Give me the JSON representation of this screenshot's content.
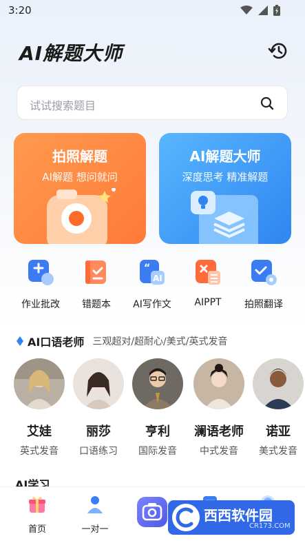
{
  "status_bar": {
    "time": "3:20"
  },
  "header": {
    "title": "AI解题大师"
  },
  "search": {
    "placeholder": "试试搜索题目"
  },
  "cards": [
    {
      "title": "拍照解题",
      "subtitle": "AI解题  想问就问"
    },
    {
      "title": "AI解题大师",
      "subtitle": "深度思考  精准解题"
    }
  ],
  "tools": [
    {
      "label": "作业批改",
      "icon": "homework-check-icon"
    },
    {
      "label": "错题本",
      "icon": "mistake-book-icon"
    },
    {
      "label": "AI写作文",
      "icon": "ai-writing-icon"
    },
    {
      "label": "AIPPT",
      "icon": "ai-ppt-icon"
    },
    {
      "label": "拍照翻译",
      "icon": "photo-translate-icon"
    }
  ],
  "oral_section": {
    "title": "AI口语老师",
    "subtitle": "三观超对/超耐心/美式/英式发音"
  },
  "teachers": [
    {
      "name": "艾娃",
      "desc": "英式发音"
    },
    {
      "name": "丽莎",
      "desc": "口语练习"
    },
    {
      "name": "亨利",
      "desc": "国际发音"
    },
    {
      "name": "澜语老师",
      "desc": "中式发音"
    },
    {
      "name": "诺亚",
      "desc": "美式发音"
    }
  ],
  "next_section": {
    "title": "AI学习"
  },
  "tabbar": [
    {
      "label": "首页",
      "icon": "gift-home-icon"
    },
    {
      "label": "一对一",
      "icon": "tutor-person-icon"
    },
    {
      "label": "",
      "icon": "camera-icon"
    },
    {
      "label": "",
      "icon": "notes-icon"
    },
    {
      "label": "",
      "icon": "profile-icon"
    }
  ],
  "watermark": {
    "text": "西西软件园",
    "domain": "CR173.COM"
  },
  "colors": {
    "orange_card": "#ff8a44",
    "blue_card": "#3b93f5",
    "accent_blue": "#2f86f0"
  }
}
